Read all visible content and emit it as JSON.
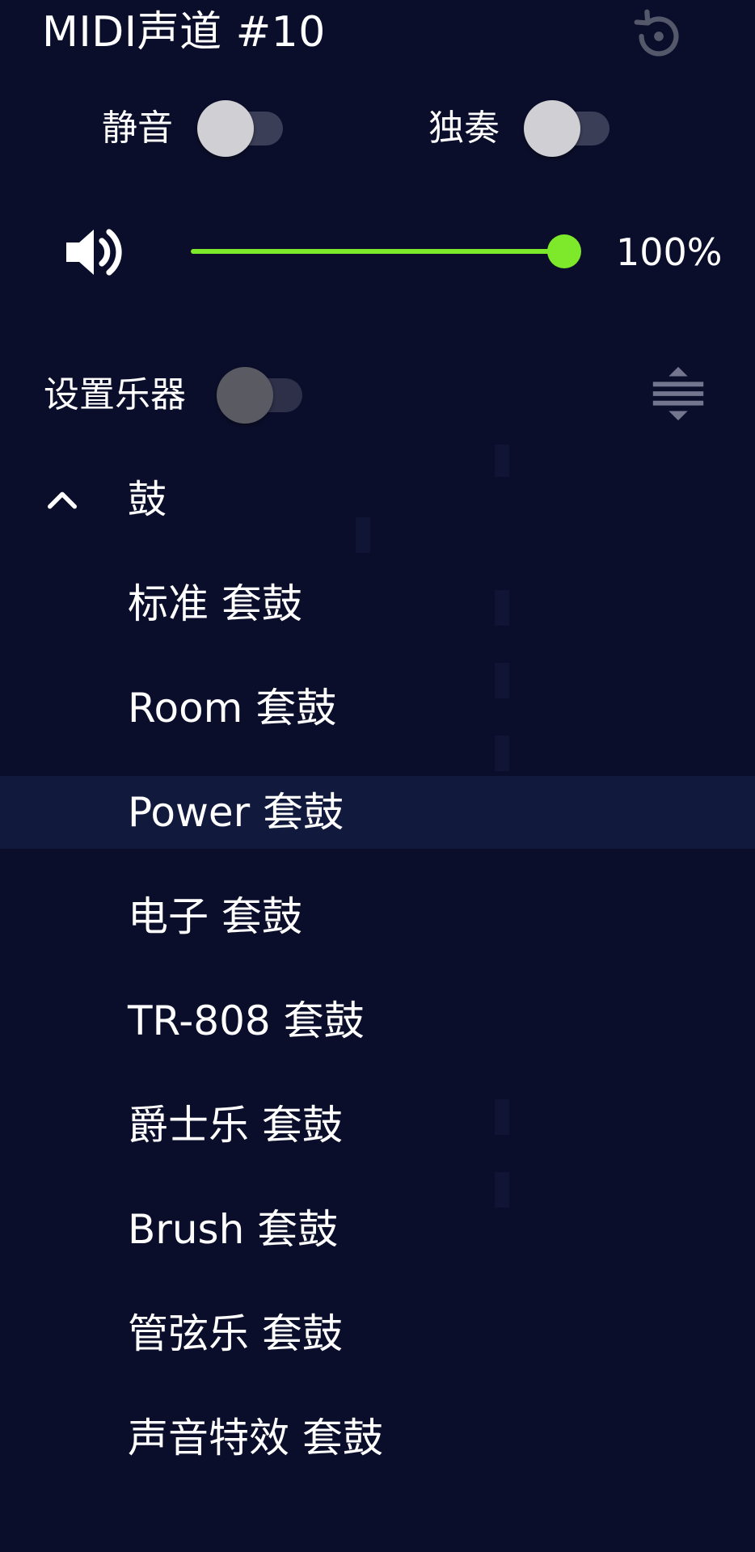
{
  "title": "MIDI声道 #10",
  "mute": {
    "label": "静音",
    "on": false
  },
  "solo": {
    "label": "独奏",
    "on": false
  },
  "volume": {
    "value": 1.0,
    "label": "100%"
  },
  "set_instrument": {
    "label": "设置乐器",
    "on": false
  },
  "group": {
    "label": "鼓",
    "expanded": true
  },
  "kits": [
    {
      "label": "标准 套鼓"
    },
    {
      "label": "Room  套鼓"
    },
    {
      "label": "Power  套鼓",
      "selected": true
    },
    {
      "label": "电子 套鼓"
    },
    {
      "label": "TR-808  套鼓"
    },
    {
      "label": "爵士乐 套鼓"
    },
    {
      "label": "Brush  套鼓"
    },
    {
      "label": "管弦乐 套鼓"
    },
    {
      "label": "声音特效 套鼓"
    }
  ],
  "colors": {
    "background": "#0b0e2a",
    "accent": "#7ee82a",
    "selected_row": "#111a3c"
  },
  "icons": {
    "restore": "restore-icon",
    "speaker": "speaker-icon",
    "sort": "sort-icon",
    "chevron": "chevron-up-icon"
  }
}
